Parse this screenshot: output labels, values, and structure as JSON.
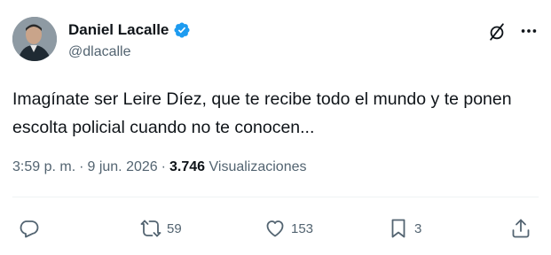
{
  "author": {
    "display_name": "Daniel Lacalle",
    "handle": "@dlacalle",
    "verified": true
  },
  "tweet": {
    "text": "Imagínate ser Leire Díez, que te recibe todo el mundo y te ponen escolta policial cuando no te conocen..."
  },
  "meta": {
    "time": "3:59 p. m.",
    "separator": "·",
    "date": "9 jun. 2026",
    "views_count": "3.746",
    "views_label": "Visualizaciones"
  },
  "actions": {
    "reply_count": "",
    "repost_count": "59",
    "like_count": "153",
    "bookmark_count": "3"
  },
  "colors": {
    "verified_blue": "#1d9bf0",
    "text_primary": "#0f1419",
    "text_secondary": "#536471",
    "divider": "#eff3f4"
  },
  "icons": {
    "grok": "grok-icon",
    "more": "more-icon",
    "reply": "reply-icon",
    "repost": "repost-icon",
    "like": "heart-icon",
    "bookmark": "bookmark-icon",
    "share": "share-icon"
  }
}
